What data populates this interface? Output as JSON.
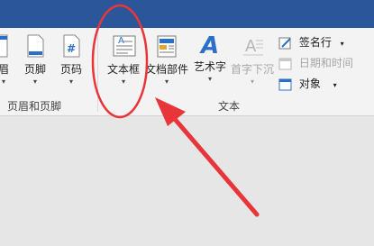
{
  "ribbon": {
    "header_footer": {
      "header_label": "眉",
      "footer_label": "页脚",
      "page_number_label": "页码",
      "page_number_glyph": "#",
      "group_label": "页眉和页脚"
    },
    "text": {
      "textbox_label": "文本框",
      "quick_parts_label": "文档部件",
      "wordart_label": "艺术字",
      "wordart_glyph": "A",
      "dropcap_label": "首字下沉",
      "signature_label": "签名行",
      "datetime_label": "日期和时间",
      "object_label": "对象",
      "group_label": "文本"
    },
    "dropdown_glyph": "▾",
    "textbox_icon_glyph": "A"
  },
  "colors": {
    "title_bar": "#2b579a",
    "ribbon_bg": "#f3f3f3",
    "document_bg": "#e6e6e6",
    "annotation_red": "#e8353a",
    "icon_blue": "#2b70c8"
  }
}
